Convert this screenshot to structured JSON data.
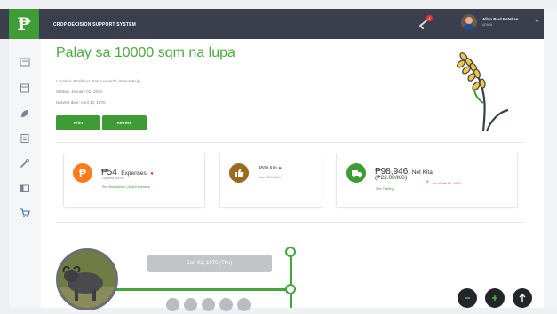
{
  "header": {
    "app_title": "CROP DECISION SUPPORT SYSTEM",
    "notification_count": "1",
    "user_name": "Allan Paul Esteban",
    "user_role": "ADMIN"
  },
  "sidebar": {
    "items": [
      {
        "icon": "dashboard-icon"
      },
      {
        "icon": "calendar-icon"
      },
      {
        "icon": "leaf-icon"
      },
      {
        "icon": "report-icon"
      },
      {
        "icon": "tools-icon"
      },
      {
        "icon": "wallet-icon"
      },
      {
        "icon": "cart-icon"
      }
    ]
  },
  "crop": {
    "title_prefix": "Palay sa ",
    "title_highlight": "10000 sqm",
    "title_suffix": " na lupa",
    "location": "Location: Bonifacio, San Leonardo, Nueva Ecija",
    "started": "Started: January 01, 1970",
    "harvest": "Harvest date: April 10, 1970",
    "print_label": "Print",
    "refresh_label": "Refresh"
  },
  "cards": {
    "expenses": {
      "value": "₱54",
      "label": "Expenses",
      "highest": "Highest: 54.00",
      "links": "See breakdown | Add Expenses",
      "icon": "peso-icon",
      "color": "#ff7a1a"
    },
    "yield": {
      "value": "4500 Kilo",
      "sub": "Max: 4200 Kilo",
      "icon": "thumbs-up-icon",
      "color": "#9b6a1e"
    },
    "profit": {
      "value": "₱98,946",
      "label": "Net Kita",
      "per_kilo": "(₱22.00/KG)",
      "link": "See Trading",
      "note": "As of Jan 01, 1970",
      "icon": "truck-icon",
      "color": "#3f9b35"
    }
  },
  "timeline": {
    "date": "Jan 01, 1970 (Thu)"
  },
  "colors": {
    "accent": "#3f9b35",
    "topbar": "#3b3f4d",
    "danger": "#e53935"
  }
}
